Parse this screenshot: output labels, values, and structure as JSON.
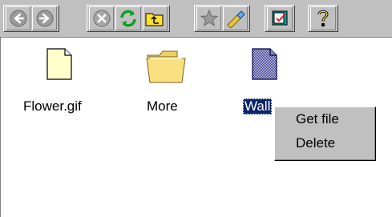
{
  "toolbar": {
    "groups": [
      {
        "buttons": [
          {
            "icon": "back-icon"
          },
          {
            "icon": "forward-icon"
          }
        ]
      },
      {
        "buttons": [
          {
            "icon": "stop-icon"
          },
          {
            "icon": "refresh-icon"
          },
          {
            "icon": "up-folder-icon"
          }
        ]
      },
      {
        "buttons": [
          {
            "icon": "favorites-icon"
          },
          {
            "icon": "flashlight-icon"
          }
        ]
      },
      {
        "buttons": [
          {
            "icon": "desktop-properties-icon"
          }
        ]
      },
      {
        "buttons": [
          {
            "icon": "help-icon"
          }
        ]
      }
    ]
  },
  "files": [
    {
      "name": "Flower.gif",
      "icon": "file-icon",
      "selected": false
    },
    {
      "name": "More",
      "icon": "folder-icon",
      "selected": false
    },
    {
      "name": "Wall",
      "icon": "image-file-icon",
      "selected": true
    }
  ],
  "context_menu": {
    "items": [
      {
        "label": "Get file"
      },
      {
        "label": "Delete"
      }
    ]
  },
  "colors": {
    "selection": "#0a246a",
    "chrome": "#c0c0c0",
    "folder": "#f0d060",
    "document": "#ffffcc"
  }
}
